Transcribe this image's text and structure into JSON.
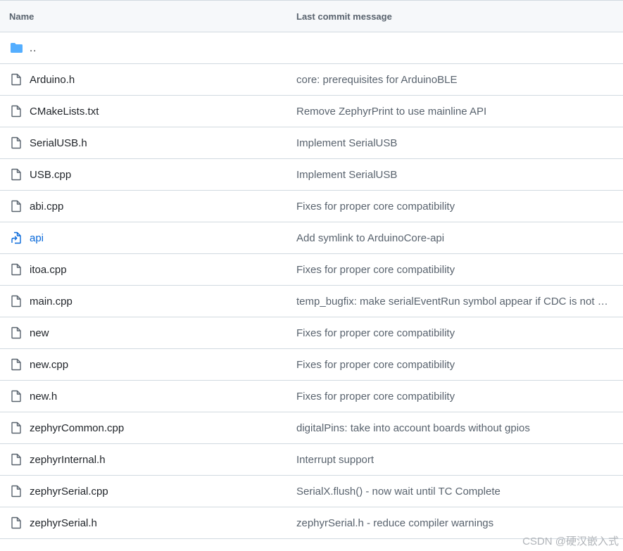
{
  "table": {
    "header": {
      "name": "Name",
      "message": "Last commit message"
    },
    "parent": {
      "label": "..",
      "icon": "folder-icon"
    },
    "rows": [
      {
        "name": "Arduino.h",
        "message": "core: prerequisites for ArduinoBLE",
        "icon": "file-icon"
      },
      {
        "name": "CMakeLists.txt",
        "message": "Remove ZephyrPrint to use mainline API",
        "icon": "file-icon"
      },
      {
        "name": "SerialUSB.h",
        "message": "Implement SerialUSB",
        "icon": "file-icon"
      },
      {
        "name": "USB.cpp",
        "message": "Implement SerialUSB",
        "icon": "file-icon"
      },
      {
        "name": "abi.cpp",
        "message": "Fixes for proper core compatibility",
        "icon": "file-icon"
      },
      {
        "name": "api",
        "message": "Add symlink to ArduinoCore-api",
        "icon": "symlink-icon"
      },
      {
        "name": "itoa.cpp",
        "message": "Fixes for proper core compatibility",
        "icon": "file-icon"
      },
      {
        "name": "main.cpp",
        "message": "temp_bugfix: make serialEventRun symbol appear if CDC is not …",
        "icon": "file-icon"
      },
      {
        "name": "new",
        "message": "Fixes for proper core compatibility",
        "icon": "file-icon"
      },
      {
        "name": "new.cpp",
        "message": "Fixes for proper core compatibility",
        "icon": "file-icon"
      },
      {
        "name": "new.h",
        "message": "Fixes for proper core compatibility",
        "icon": "file-icon"
      },
      {
        "name": "zephyrCommon.cpp",
        "message": "digitalPins: take into account boards without gpios",
        "icon": "file-icon"
      },
      {
        "name": "zephyrInternal.h",
        "message": "Interrupt support",
        "icon": "file-icon"
      },
      {
        "name": "zephyrSerial.cpp",
        "message": "SerialX.flush() - now wait until TC Complete",
        "icon": "file-icon"
      },
      {
        "name": "zephyrSerial.h",
        "message": "zephyrSerial.h - reduce compiler warnings",
        "icon": "file-icon"
      }
    ]
  },
  "watermark": "CSDN @硬汉嵌入式",
  "colors": {
    "folder": "#54aeff",
    "link": "#0969da",
    "icon": "#59636e"
  }
}
